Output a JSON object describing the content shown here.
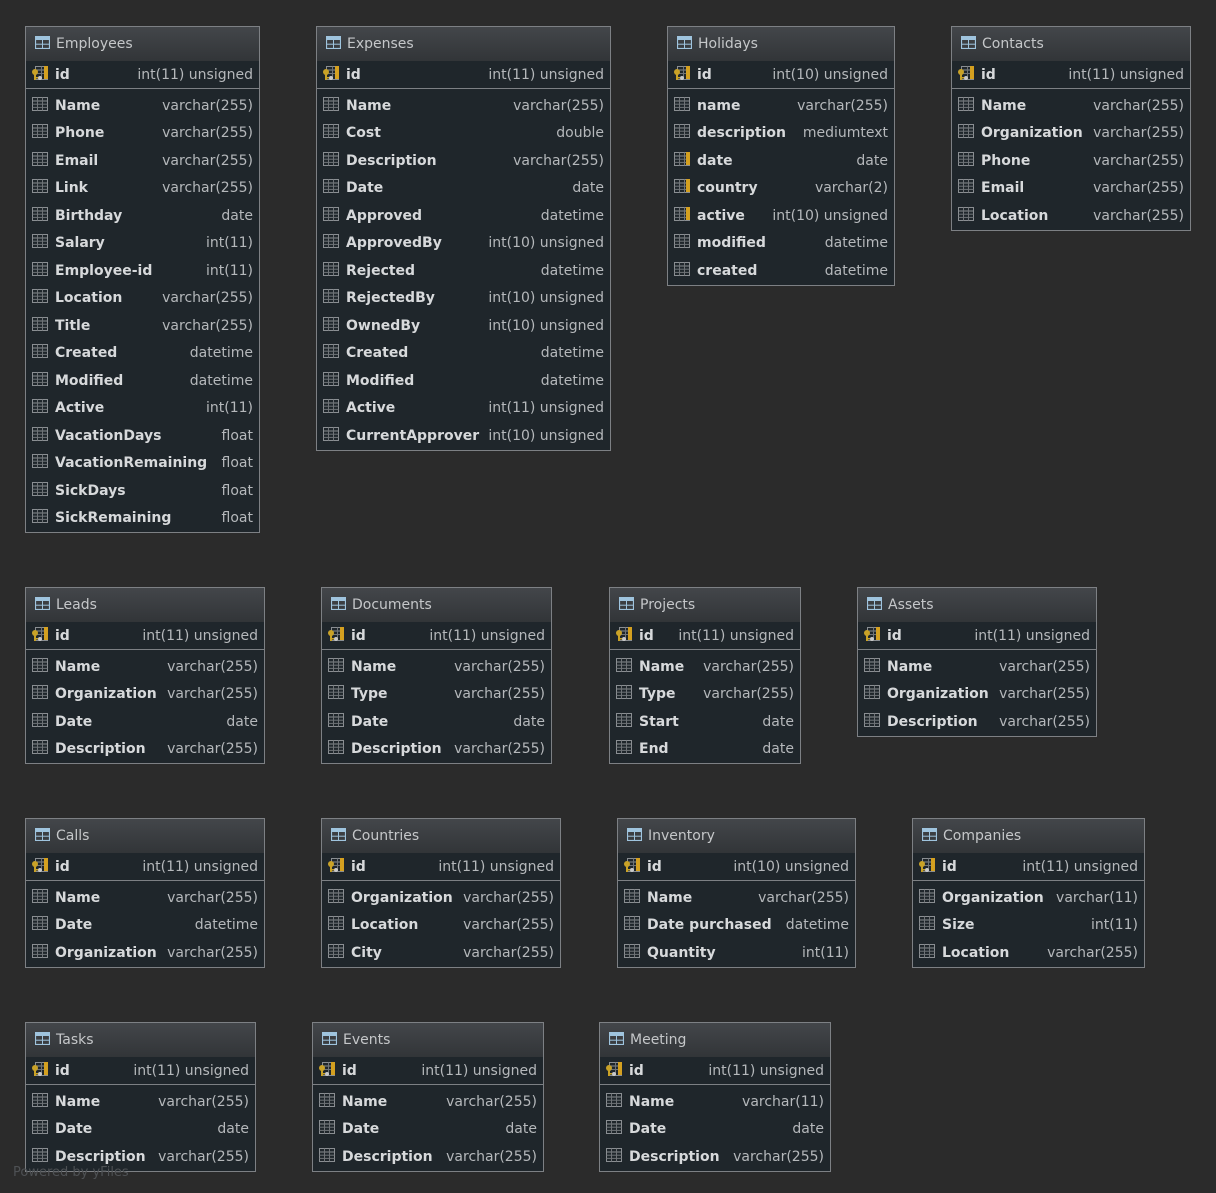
{
  "tables": [
    {
      "name": "Employees",
      "key": "employees",
      "pk": {
        "name": "id",
        "type": "int(11) unsigned"
      },
      "fields": [
        {
          "name": "Name",
          "type": "varchar(255)"
        },
        {
          "name": "Phone",
          "type": "varchar(255)"
        },
        {
          "name": "Email",
          "type": "varchar(255)"
        },
        {
          "name": "Link",
          "type": "varchar(255)"
        },
        {
          "name": "Birthday",
          "type": "date"
        },
        {
          "name": "Salary",
          "type": "int(11)"
        },
        {
          "name": "Employee-id",
          "type": "int(11)"
        },
        {
          "name": "Location",
          "type": "varchar(255)"
        },
        {
          "name": "Title",
          "type": "varchar(255)"
        },
        {
          "name": "Created",
          "type": "datetime"
        },
        {
          "name": "Modified",
          "type": "datetime"
        },
        {
          "name": "Active",
          "type": "int(11)"
        },
        {
          "name": "VacationDays",
          "type": "float"
        },
        {
          "name": "VacationRemaining",
          "type": "float"
        },
        {
          "name": "SickDays",
          "type": "float"
        },
        {
          "name": "SickRemaining",
          "type": "float"
        }
      ]
    },
    {
      "name": "Expenses",
      "key": "expenses",
      "pk": {
        "name": "id",
        "type": "int(11) unsigned"
      },
      "fields": [
        {
          "name": "Name",
          "type": "varchar(255)"
        },
        {
          "name": "Cost",
          "type": "double"
        },
        {
          "name": "Description",
          "type": "varchar(255)"
        },
        {
          "name": "Date",
          "type": "date"
        },
        {
          "name": "Approved",
          "type": "datetime"
        },
        {
          "name": "ApprovedBy",
          "type": "int(10) unsigned"
        },
        {
          "name": "Rejected",
          "type": "datetime"
        },
        {
          "name": "RejectedBy",
          "type": "int(10) unsigned"
        },
        {
          "name": "OwnedBy",
          "type": "int(10) unsigned"
        },
        {
          "name": "Created",
          "type": "datetime"
        },
        {
          "name": "Modified",
          "type": "datetime"
        },
        {
          "name": "Active",
          "type": "int(11) unsigned"
        },
        {
          "name": "CurrentApprover",
          "type": "int(10) unsigned"
        }
      ]
    },
    {
      "name": "Holidays",
      "key": "holidays",
      "pk": {
        "name": "id",
        "type": "int(10) unsigned"
      },
      "fields": [
        {
          "name": "name",
          "type": "varchar(255)"
        },
        {
          "name": "description",
          "type": "mediumtext"
        },
        {
          "name": "date",
          "type": "date",
          "indexed": true
        },
        {
          "name": "country",
          "type": "varchar(2)",
          "indexed": true
        },
        {
          "name": "active",
          "type": "int(10) unsigned",
          "indexed": true
        },
        {
          "name": "modified",
          "type": "datetime"
        },
        {
          "name": "created",
          "type": "datetime"
        }
      ]
    },
    {
      "name": "Contacts",
      "key": "contacts",
      "pk": {
        "name": "id",
        "type": "int(11) unsigned"
      },
      "fields": [
        {
          "name": "Name",
          "type": "varchar(255)"
        },
        {
          "name": "Organization",
          "type": "varchar(255)"
        },
        {
          "name": "Phone",
          "type": "varchar(255)"
        },
        {
          "name": "Email",
          "type": "varchar(255)"
        },
        {
          "name": "Location",
          "type": "varchar(255)"
        }
      ]
    },
    {
      "name": "Leads",
      "key": "leads",
      "pk": {
        "name": "id",
        "type": "int(11) unsigned"
      },
      "fields": [
        {
          "name": "Name",
          "type": "varchar(255)"
        },
        {
          "name": "Organization",
          "type": "varchar(255)"
        },
        {
          "name": "Date",
          "type": "date"
        },
        {
          "name": "Description",
          "type": "varchar(255)"
        }
      ]
    },
    {
      "name": "Documents",
      "key": "documents",
      "pk": {
        "name": "id",
        "type": "int(11) unsigned"
      },
      "fields": [
        {
          "name": "Name",
          "type": "varchar(255)"
        },
        {
          "name": "Type",
          "type": "varchar(255)"
        },
        {
          "name": "Date",
          "type": "date"
        },
        {
          "name": "Description",
          "type": "varchar(255)"
        }
      ]
    },
    {
      "name": "Projects",
      "key": "projects",
      "pk": {
        "name": "id",
        "type": "int(11) unsigned"
      },
      "fields": [
        {
          "name": "Name",
          "type": "varchar(255)"
        },
        {
          "name": "Type",
          "type": "varchar(255)"
        },
        {
          "name": "Start",
          "type": "date"
        },
        {
          "name": "End",
          "type": "date"
        }
      ]
    },
    {
      "name": "Assets",
      "key": "assets",
      "pk": {
        "name": "id",
        "type": "int(11) unsigned"
      },
      "fields": [
        {
          "name": "Name",
          "type": "varchar(255)"
        },
        {
          "name": "Organization",
          "type": "varchar(255)"
        },
        {
          "name": "Description",
          "type": "varchar(255)"
        }
      ]
    },
    {
      "name": "Calls",
      "key": "calls",
      "pk": {
        "name": "id",
        "type": "int(11) unsigned"
      },
      "fields": [
        {
          "name": "Name",
          "type": "varchar(255)"
        },
        {
          "name": "Date",
          "type": "datetime"
        },
        {
          "name": "Organization",
          "type": "varchar(255)"
        }
      ]
    },
    {
      "name": "Countries",
      "key": "countries",
      "pk": {
        "name": "id",
        "type": "int(11) unsigned"
      },
      "fields": [
        {
          "name": "Organization",
          "type": "varchar(255)"
        },
        {
          "name": "Location",
          "type": "varchar(255)"
        },
        {
          "name": "City",
          "type": "varchar(255)"
        }
      ]
    },
    {
      "name": "Inventory",
      "key": "inventory",
      "pk": {
        "name": "id",
        "type": "int(10) unsigned"
      },
      "fields": [
        {
          "name": "Name",
          "type": "varchar(255)"
        },
        {
          "name": "Date purchased",
          "type": "datetime"
        },
        {
          "name": "Quantity",
          "type": "int(11)"
        }
      ]
    },
    {
      "name": "Companies",
      "key": "companies",
      "pk": {
        "name": "id",
        "type": "int(11) unsigned"
      },
      "fields": [
        {
          "name": "Organization",
          "type": "varchar(11)"
        },
        {
          "name": "Size",
          "type": "int(11)"
        },
        {
          "name": "Location",
          "type": "varchar(255)"
        }
      ]
    },
    {
      "name": "Tasks",
      "key": "tasks",
      "pk": {
        "name": "id",
        "type": "int(11) unsigned"
      },
      "fields": [
        {
          "name": "Name",
          "type": "varchar(255)"
        },
        {
          "name": "Date",
          "type": "date"
        },
        {
          "name": "Description",
          "type": "varchar(255)"
        }
      ]
    },
    {
      "name": "Events",
      "key": "events",
      "pk": {
        "name": "id",
        "type": "int(11) unsigned"
      },
      "fields": [
        {
          "name": "Name",
          "type": "varchar(255)"
        },
        {
          "name": "Date",
          "type": "date"
        },
        {
          "name": "Description",
          "type": "varchar(255)"
        }
      ]
    },
    {
      "name": "Meeting",
      "key": "meeting",
      "pk": {
        "name": "id",
        "type": "int(11) unsigned"
      },
      "fields": [
        {
          "name": "Name",
          "type": "varchar(11)"
        },
        {
          "name": "Date",
          "type": "date"
        },
        {
          "name": "Description",
          "type": "varchar(255)"
        }
      ]
    }
  ],
  "watermark": "Powered by yFiles",
  "colors": {
    "background": "#2b2b2b",
    "table_body": "#1f262b",
    "header": "#3a3d40",
    "border": "#7d8084",
    "key": "#c9a227",
    "index": "#d4a020"
  }
}
